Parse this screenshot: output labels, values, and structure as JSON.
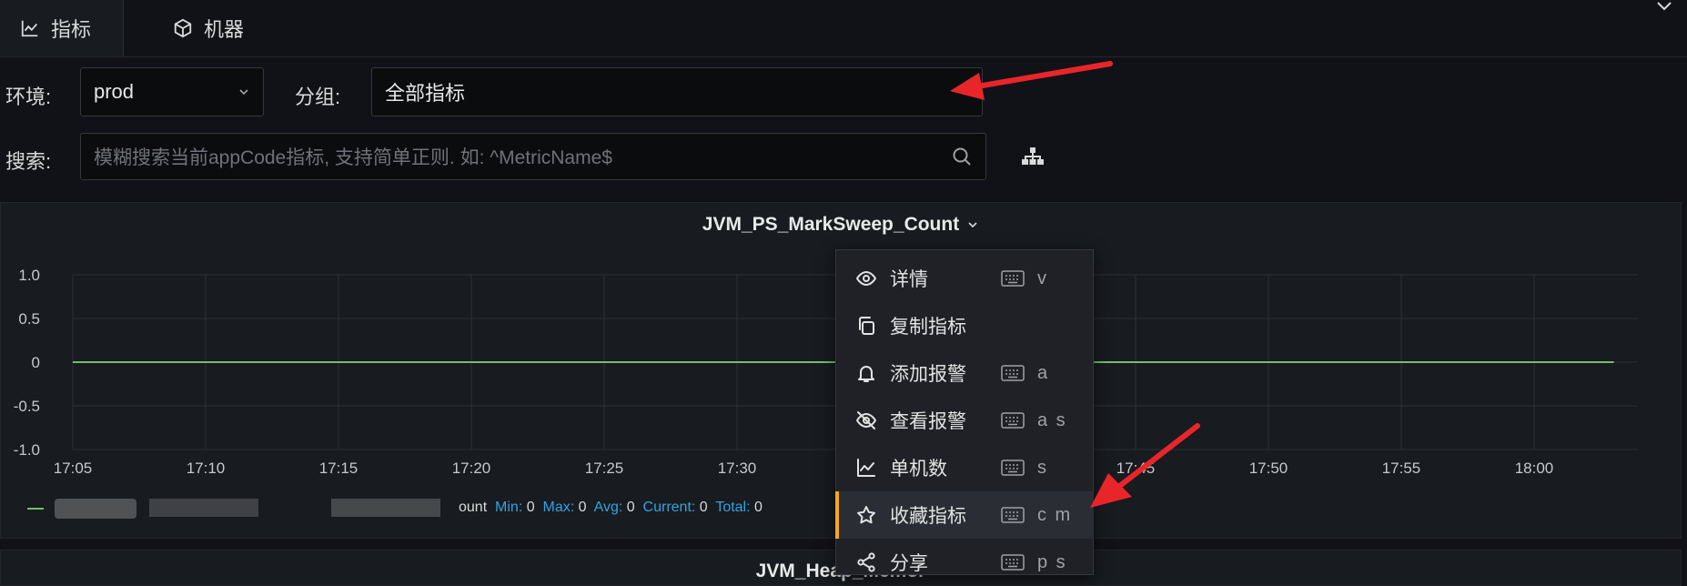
{
  "tabs": [
    {
      "label": "指标",
      "icon": "line-chart-icon",
      "active": true
    },
    {
      "label": "机器",
      "icon": "cube-icon",
      "active": false
    }
  ],
  "filters": {
    "env_label": "环境:",
    "env_value": "prod",
    "group_label": "分组:",
    "group_value": "全部指标",
    "search_label": "搜索:",
    "search_placeholder": "模糊搜索当前appCode指标, 支持简单正则. 如: ^MetricName$"
  },
  "panel": {
    "title": "JVM_PS_MarkSweep_Count",
    "legend": {
      "visible_suffix": "ount",
      "min_label": "Min:",
      "min_value": "0",
      "max_label": "Max:",
      "max_value": "0",
      "avg_label": "Avg:",
      "avg_value": "0",
      "current_label": "Current:",
      "current_value": "0",
      "total_label": "Total:",
      "total_value": "0"
    }
  },
  "chart_data": {
    "type": "line",
    "x": [
      "17:05",
      "17:10",
      "17:15",
      "17:20",
      "17:25",
      "17:30",
      "17:35",
      "17:40",
      "17:45",
      "17:50",
      "17:55",
      "18:00",
      "18:03"
    ],
    "x_tick_labels": [
      "17:05",
      "17:10",
      "17:15",
      "17:20",
      "17:25",
      "17:30",
      "17:35",
      "17:40",
      "17:45",
      "17:50",
      "17:55",
      "18:00"
    ],
    "y_tick_labels": [
      "1.0",
      "0.5",
      "0",
      "-0.5",
      "-1.0"
    ],
    "ylim": [
      -1.0,
      1.0
    ],
    "series": [
      {
        "values": [
          0,
          0,
          0,
          0,
          0,
          0,
          0,
          0,
          0,
          0,
          0,
          0,
          0
        ]
      }
    ],
    "grid": true,
    "line_color": "#73bf69"
  },
  "context_menu": {
    "items": [
      {
        "label": "详情",
        "icon": "eye-icon",
        "shortcut": "v"
      },
      {
        "label": "复制指标",
        "icon": "copy-icon",
        "shortcut": ""
      },
      {
        "label": "添加报警",
        "icon": "bell-icon",
        "shortcut": "a"
      },
      {
        "label": "查看报警",
        "icon": "eye-slash-icon",
        "shortcut": "a s"
      },
      {
        "label": "单机数",
        "icon": "line-chart-icon",
        "shortcut": "s"
      },
      {
        "label": "收藏指标",
        "icon": "star-icon",
        "shortcut": "c m",
        "highlighted": true
      },
      {
        "label": "分享",
        "icon": "share-icon",
        "shortcut": "p s"
      }
    ]
  },
  "next_panel": {
    "title": "JVM_Heap_Memor"
  },
  "colors": {
    "accent_arrow": "#e8262a",
    "highlight_bar": "#f5a623",
    "legend_key": "#33a2e5"
  }
}
